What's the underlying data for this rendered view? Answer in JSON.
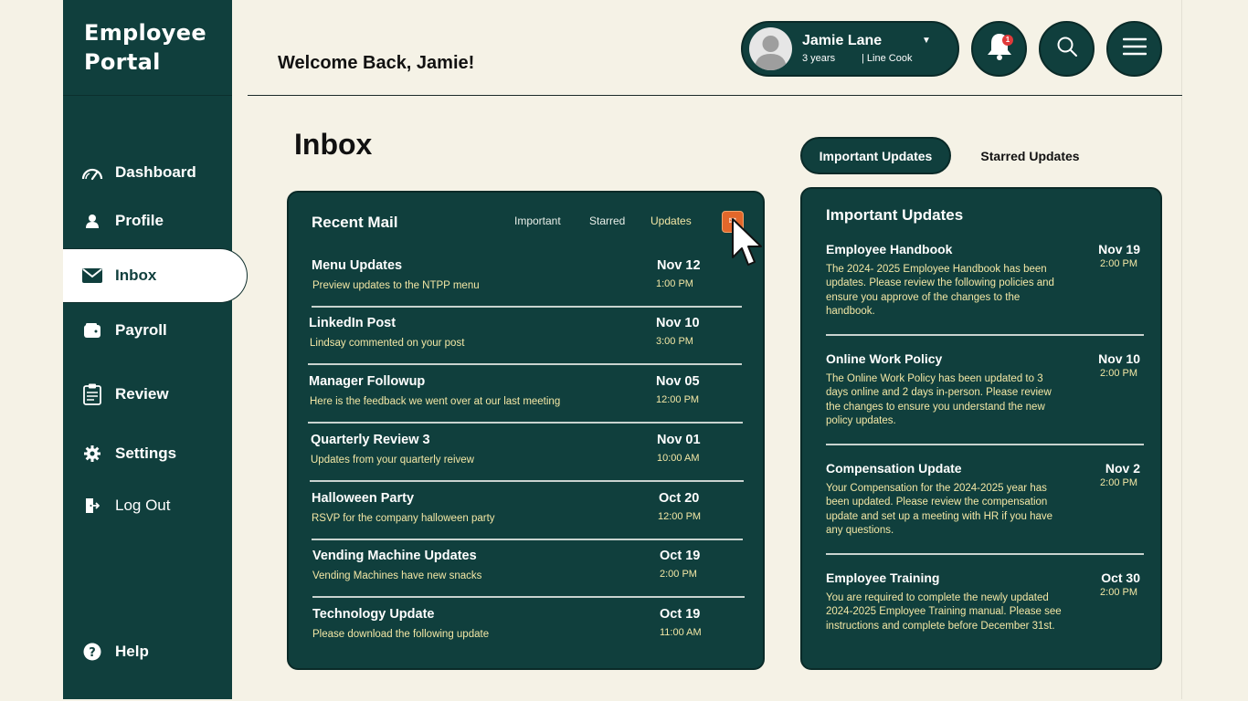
{
  "brand": {
    "line1": "Employee",
    "line2": "Portal"
  },
  "header": {
    "welcome": "Welcome Back, Jamie!"
  },
  "user": {
    "name": "Jamie Lane",
    "tenure": "3 years",
    "role": "| Line Cook",
    "notification_count": "1"
  },
  "sidebar": {
    "items": [
      {
        "label": "Dashboard",
        "icon": "gauge-icon"
      },
      {
        "label": "Profile",
        "icon": "user-icon"
      },
      {
        "label": "Inbox",
        "icon": "mail-icon"
      },
      {
        "label": "Payroll",
        "icon": "wallet-icon"
      },
      {
        "label": "Review",
        "icon": "clipboard-icon"
      },
      {
        "label": "Settings",
        "icon": "gear-icon"
      },
      {
        "label": "Log Out",
        "icon": "logout-icon"
      }
    ],
    "help": "Help"
  },
  "inbox": {
    "title": "Inbox",
    "card_title": "Recent Mail",
    "filters": [
      "Important",
      "Starred",
      "Updates"
    ],
    "mails": [
      {
        "subject": "Menu Updates",
        "preview": "Preview updates to the NTPP menu",
        "date": "Nov 12",
        "time": "1:00 PM"
      },
      {
        "subject": "LinkedIn Post",
        "preview": "Lindsay commented on your post",
        "date": "Nov 10",
        "time": "3:00 PM"
      },
      {
        "subject": "Manager Followup",
        "preview": "Here is the feedback we went over at our last meeting",
        "date": "Nov 05",
        "time": "12:00 PM"
      },
      {
        "subject": "Quarterly Review 3",
        "preview": "Updates from your quarterly reivew",
        "date": "Nov 01",
        "time": "10:00 AM"
      },
      {
        "subject": "Halloween Party",
        "preview": "RSVP for the company halloween party",
        "date": "Oct 20",
        "time": "12:00 PM"
      },
      {
        "subject": "Vending Machine Updates",
        "preview": "Vending Machines have new snacks",
        "date": "Oct 19",
        "time": "2:00 PM"
      },
      {
        "subject": "Technology Update",
        "preview": "Please download the following update",
        "date": "Oct 19",
        "time": "11:00 AM"
      }
    ]
  },
  "updates": {
    "tabs": [
      "Important Updates",
      "Starred Updates"
    ],
    "card_title": "Important Updates",
    "items": [
      {
        "title": "Employee Handbook",
        "date": "Nov 19",
        "time": "2:00 PM",
        "body": "The 2024- 2025 Employee Handbook has been updates. Please review the following policies and ensure you approve of the changes to the handbook."
      },
      {
        "title": "Online Work Policy",
        "date": "Nov 10",
        "time": "2:00 PM",
        "body": "The Online Work Policy has been updated to 3 days online and 2 days in-person. Please review the changes to ensure you understand the new policy updates."
      },
      {
        "title": "Compensation Update",
        "date": "Nov 2",
        "time": "2:00 PM",
        "body": "Your Compensation for the 2024-2025 year has been updated. Please review the compensation update and set up a meeting with HR if you have any questions."
      },
      {
        "title": "Employee Training",
        "date": "Oct 30",
        "time": "2:00 PM",
        "body": "You are required to complete the newly updated 2024-2025 Employee Training manual. Please see instructions and complete before December 31st."
      }
    ]
  },
  "colors": {
    "primary": "#103f3d",
    "background": "#f5f2e6",
    "accent_text": "#f3e7a5",
    "orange": "#e2672b"
  }
}
